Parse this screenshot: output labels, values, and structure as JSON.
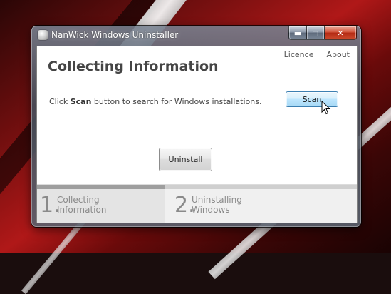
{
  "window": {
    "title": "NanWick Windows Uninstaller",
    "minimize_glyph": "▬",
    "maximize_glyph": "◻",
    "close_glyph": "✕"
  },
  "links": {
    "licence": "Licence",
    "about": "About"
  },
  "main": {
    "heading": "Collecting Information",
    "instruction_prefix": "Click",
    "instruction_keyword": "Scan",
    "instruction_suffix": "button to search for Windows installations.",
    "scan_label": "Scan",
    "uninstall_label": "Uninstall"
  },
  "steps": [
    {
      "number": "1.",
      "line1": "Collecting",
      "line2": "Information",
      "active": true
    },
    {
      "number": "2.",
      "line1": "Uninstalling",
      "line2": "Windows",
      "active": false
    }
  ],
  "icons": {
    "app": "app-icon",
    "cursor": "mouse-pointer-icon"
  }
}
